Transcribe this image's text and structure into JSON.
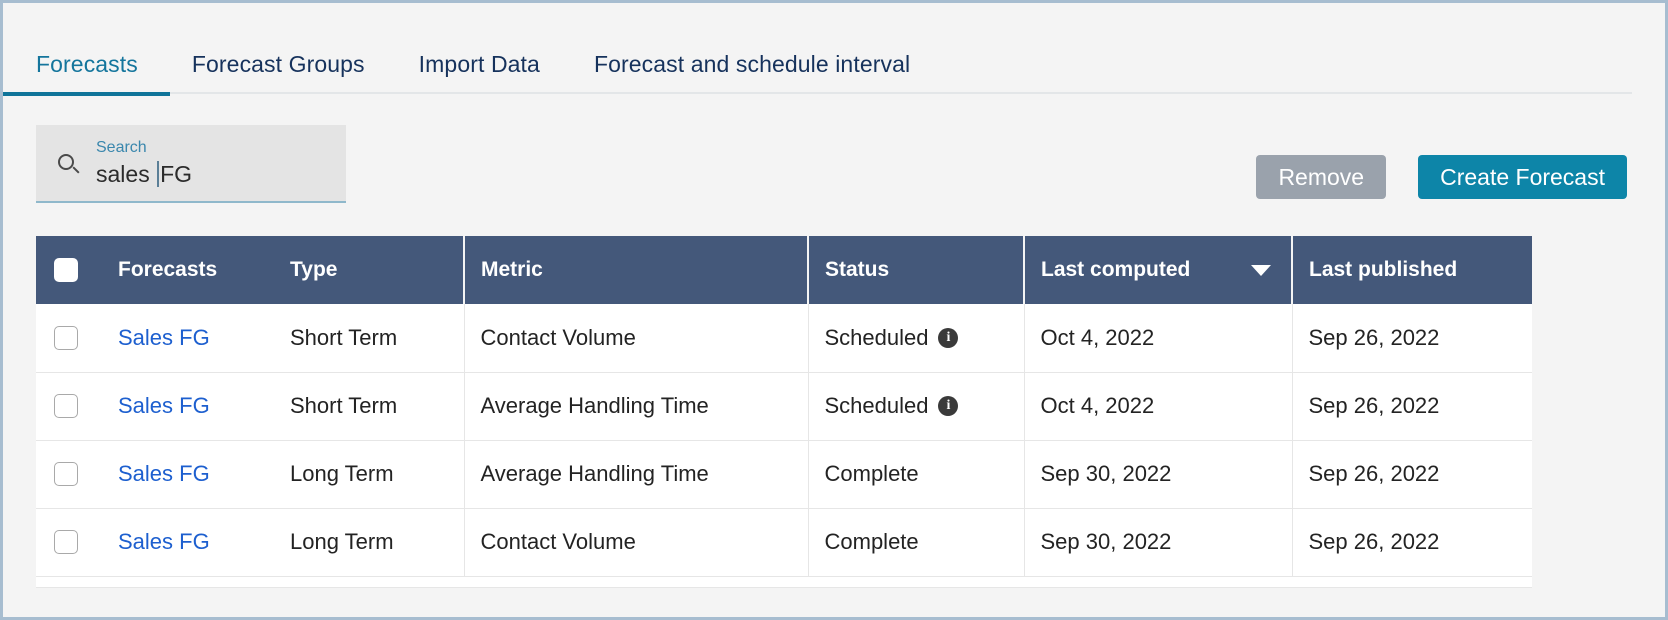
{
  "tabs": [
    {
      "label": "Forecasts",
      "active": true
    },
    {
      "label": "Forecast Groups",
      "active": false
    },
    {
      "label": "Import Data",
      "active": false
    },
    {
      "label": "Forecast and schedule interval",
      "active": false
    }
  ],
  "search": {
    "label": "Search",
    "value_before_caret": "sales ",
    "value_after_caret": "FG",
    "full_value": "sales FG",
    "placeholder": "Search",
    "icon": "search-icon"
  },
  "toolbar": {
    "remove_label": "Remove",
    "create_label": "Create Forecast"
  },
  "table": {
    "columns": [
      {
        "key": "check",
        "label": ""
      },
      {
        "key": "forecasts",
        "label": "Forecasts"
      },
      {
        "key": "type",
        "label": "Type"
      },
      {
        "key": "metric",
        "label": "Metric"
      },
      {
        "key": "status",
        "label": "Status"
      },
      {
        "key": "last_computed",
        "label": "Last computed",
        "sorted": "desc",
        "sort_icon": "caret-down-icon"
      },
      {
        "key": "last_published",
        "label": "Last published"
      }
    ],
    "rows": [
      {
        "name": "Sales FG",
        "type": "Short Term",
        "metric": "Contact Volume",
        "status": "Scheduled",
        "status_info_icon": "info-icon",
        "last_computed": "Oct 4, 2022",
        "last_published": "Sep 26, 2022"
      },
      {
        "name": "Sales FG",
        "type": "Short Term",
        "metric": "Average Handling Time",
        "status": "Scheduled",
        "status_info_icon": "info-icon",
        "last_computed": "Oct 4, 2022",
        "last_published": "Sep 26, 2022"
      },
      {
        "name": "Sales FG",
        "type": "Long Term",
        "metric": "Average Handling Time",
        "status": "Complete",
        "status_info_icon": null,
        "last_computed": "Sep 30, 2022",
        "last_published": "Sep 26, 2022"
      },
      {
        "name": "Sales FG",
        "type": "Long Term",
        "metric": "Contact Volume",
        "status": "Complete",
        "status_info_icon": null,
        "last_computed": "Sep 30, 2022",
        "last_published": "Sep 26, 2022"
      }
    ]
  },
  "colors": {
    "accent_teal": "#0d85a8",
    "active_tab_text": "#14759c",
    "inactive_tab_text": "#16325c",
    "table_header_bg": "#44587a",
    "link_blue": "#1d5fcf",
    "remove_button_bg": "#9aa2ac",
    "page_bg": "#f4f4f4"
  }
}
